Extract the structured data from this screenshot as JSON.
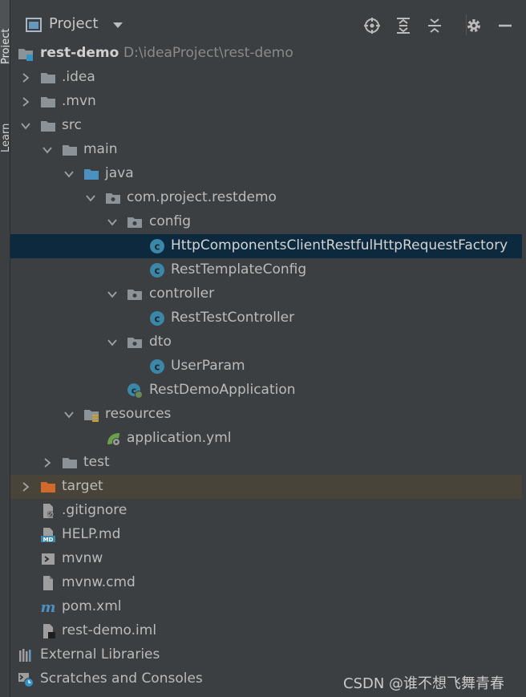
{
  "side_tabs": {
    "project": "Project",
    "learn": "Learn"
  },
  "header": {
    "title": "Project"
  },
  "tree": {
    "root_name": "rest-demo",
    "root_path": "D:\\ideaProject\\rest-demo",
    "nodes": {
      "idea": ".idea",
      "mvn": ".mvn",
      "src": "src",
      "main": "main",
      "java": "java",
      "package": "com.project.restdemo",
      "config": "config",
      "factory": "HttpComponentsClientRestfulHttpRequestFactory",
      "rest_template_config": "RestTemplateConfig",
      "controller": "controller",
      "rest_test_controller": "RestTestController",
      "dto": "dto",
      "user_param": "UserParam",
      "rest_demo_application": "RestDemoApplication",
      "resources": "resources",
      "application_yml": "application.yml",
      "test": "test",
      "target": "target",
      "gitignore": ".gitignore",
      "help_md": "HELP.md",
      "mvnw": "mvnw",
      "mvnw_cmd": "mvnw.cmd",
      "pom_xml": "pom.xml",
      "rest_demo_iml": "rest-demo.iml"
    },
    "external_libraries": "External Libraries",
    "scratches": "Scratches and Consoles"
  },
  "watermark": "CSDN @谁不想飞舞青春",
  "colors": {
    "background": "#3c3f41",
    "selection": "#0d293e",
    "excluded": "#49443a",
    "folder": "#8c9398",
    "source_folder": "#4a90c0",
    "excluded_folder": "#d0692b",
    "class_icon": "#3a87a8"
  }
}
